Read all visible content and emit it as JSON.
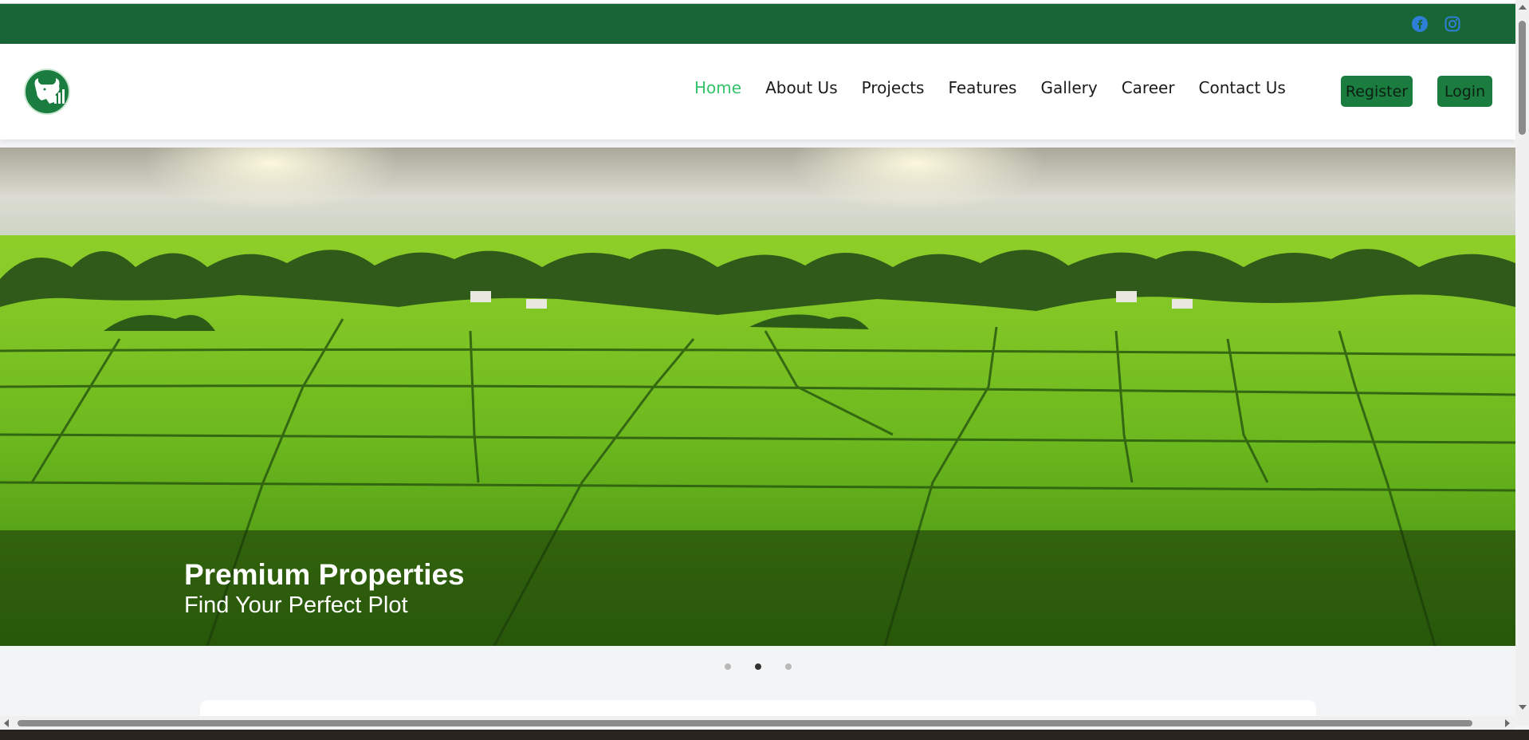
{
  "topbar": {
    "background": "#186535",
    "social_icons": [
      "facebook-icon",
      "instagram-icon"
    ],
    "icon_color": "#2f7fd8"
  },
  "nav": {
    "items": [
      {
        "label": "Home",
        "active": true
      },
      {
        "label": "About Us"
      },
      {
        "label": "Projects"
      },
      {
        "label": "Features"
      },
      {
        "label": "Gallery"
      },
      {
        "label": "Career"
      },
      {
        "label": "Contact Us"
      }
    ],
    "active_color": "#34c26a"
  },
  "auth": {
    "register_label": "Register",
    "login_label": "Login",
    "button_color": "#1a7d3f"
  },
  "hero": {
    "title": "Premium Properties",
    "subtitle": "Find Your Perfect Plot",
    "active_slide": 2,
    "slide_count": 3
  },
  "colors": {
    "brand_green": "#186535",
    "page_bg": "#f3f4f6"
  }
}
